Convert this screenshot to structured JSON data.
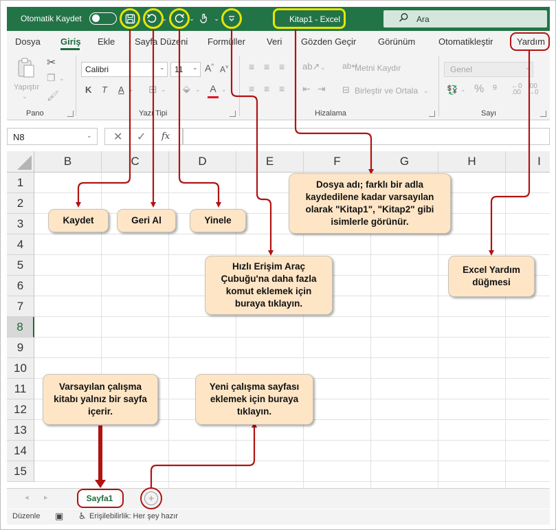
{
  "titlebar": {
    "autosave_label": "Otomatik Kaydet",
    "document_title": "Kitap1  -  Excel",
    "search_placeholder": "Ara"
  },
  "ribbon_tabs": [
    "Dosya",
    "Giriş",
    "Ekle",
    "Sayfa Düzeni",
    "Formüller",
    "Veri",
    "Gözden Geçir",
    "Görünüm",
    "Otomatikleştir",
    "Yardım"
  ],
  "active_tab": "Giriş",
  "ribbon": {
    "paste_label": "Yapıştır",
    "font_name": "Calibri",
    "font_size": "11",
    "bold": "K",
    "italic": "T",
    "underline": "A",
    "wrap_text": "Metni Kaydır",
    "merge_center": "Birleştir ve Ortala",
    "number_format": "Genel",
    "groups": {
      "clipboard": "Pano",
      "font": "Yazı Tipi",
      "alignment": "Hizalama",
      "number": "Sayı"
    }
  },
  "formula_bar": {
    "name_box": "N8",
    "fx": "fx"
  },
  "grid": {
    "columns": [
      "B",
      "C",
      "D",
      "E",
      "F",
      "G",
      "H",
      "I"
    ],
    "rows": [
      "1",
      "2",
      "3",
      "4",
      "5",
      "6",
      "7",
      "8",
      "9",
      "10",
      "11",
      "12",
      "13",
      "14",
      "15"
    ],
    "selected_row": "8"
  },
  "sheets": {
    "active": "Sayfa1",
    "add_symbol": "+"
  },
  "status": {
    "mode": "Düzenle",
    "accessibility": "Erişilebilirlik: Her şey hazır"
  },
  "callouts": {
    "save": "Kaydet",
    "undo": "Geri Al",
    "redo": "Yinele",
    "filename": "Dosya adı; farklı bir adla kaydedilene kadar varsayılan olarak \"Kitap1\", \"Kitap2\" gibi isimlerle görünür.",
    "qat": "Hızlı Erişim Araç Çubuğu'na daha fazla komut eklemek için buraya tıklayın.",
    "help": "Excel Yardım düğmesi",
    "default_sheet": "Varsayılan çalışma kitabı yalnız bir sayfa içerir.",
    "new_sheet": "Yeni çalışma sayfası eklemek için buraya tıklayın."
  },
  "colors": {
    "excel_green": "#227447",
    "highlight_yellow": "#e6e600",
    "arrow_red": "#b11212",
    "callout_fill": "#fde5c6"
  }
}
